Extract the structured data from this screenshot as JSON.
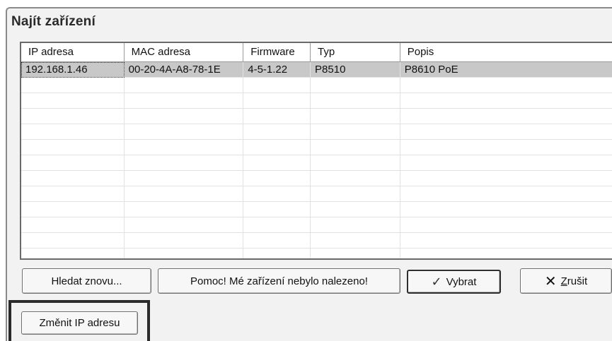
{
  "dialog": {
    "title": "Najít zařízení"
  },
  "list": {
    "columns": [
      "IP adresa",
      "MAC adresa",
      "Firmware",
      "Typ",
      "Popis"
    ],
    "rows": [
      [
        "192.168.1.46",
        "00-20-4A-A8-78-1E",
        "4-5-1.22",
        "P8510",
        "P8610 PoE"
      ]
    ]
  },
  "buttons": {
    "search_again": "Hledat znovu...",
    "help": "Pomoc! Mé zařízení nebylo nalezeno!",
    "select": "Vybrat",
    "cancel": "Zrušit",
    "change_ip": "Změnit IP adresu"
  },
  "icons": {
    "select": "check-icon",
    "cancel": "x-icon"
  }
}
